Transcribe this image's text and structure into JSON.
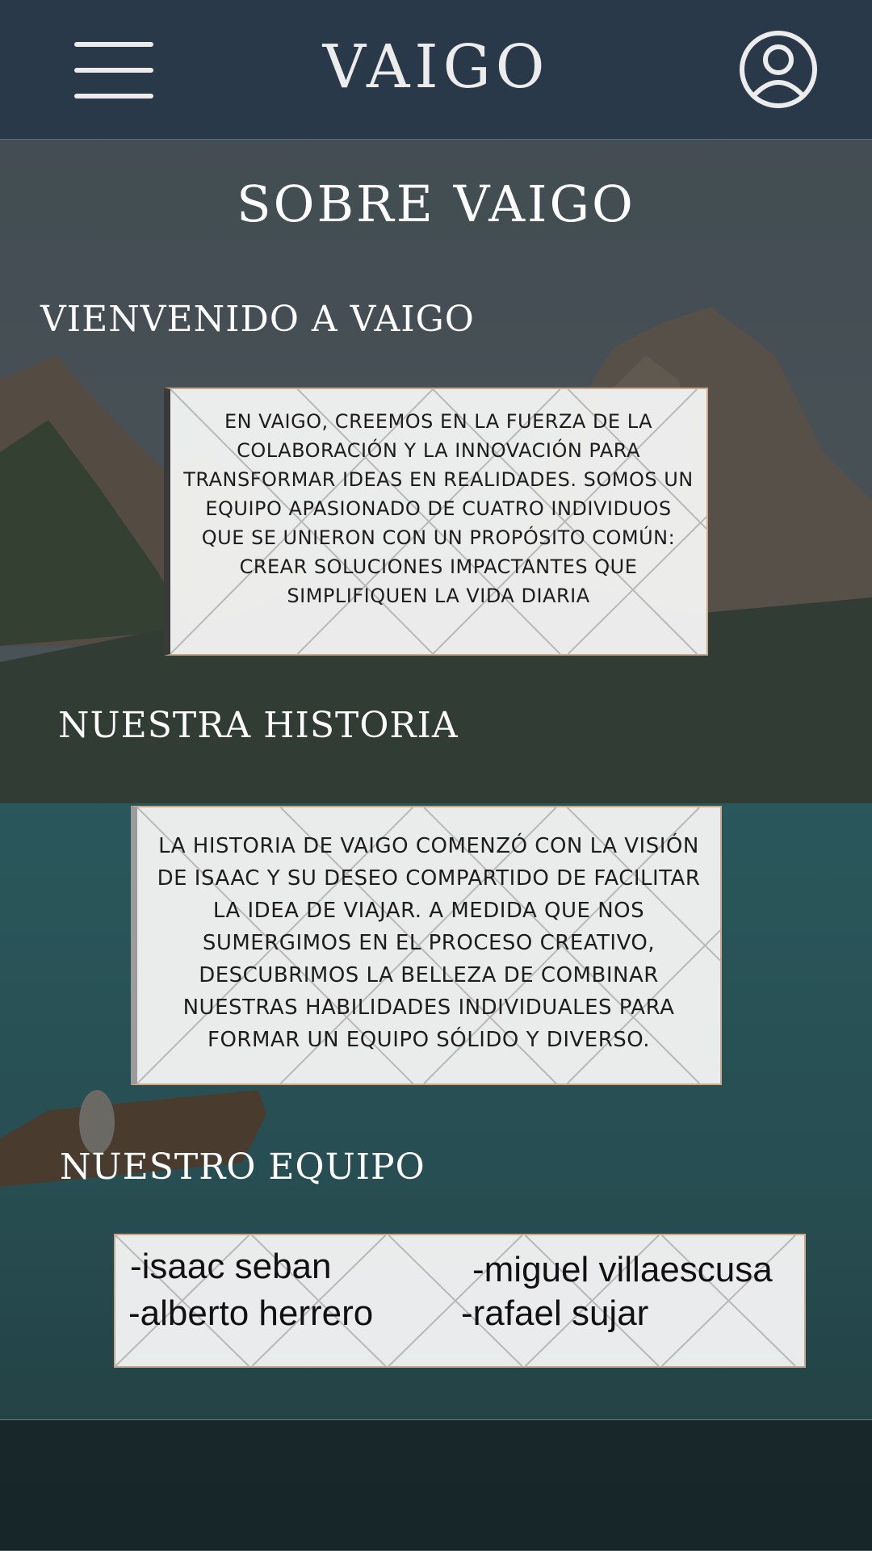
{
  "header": {
    "brand": "VAIGO",
    "menu_icon": "hamburger-menu-icon",
    "profile_icon": "user-profile-icon"
  },
  "page": {
    "title": "SOBRE VAIGO"
  },
  "welcome": {
    "heading": "VIENVENIDO A VAIGO",
    "text": "EN VAIGO, CREEMOS EN LA FUERZA DE LA COLABORACIÓN Y LA INNOVACIÓN PARA TRANSFORMAR IDEAS EN REALIDADES. SOMOS UN EQUIPO APASIONADO DE CUATRO INDIVIDUOS QUE SE UNIERON CON UN PROPÓSITO COMÚN: CREAR SOLUCIONES IMPACTANTES QUE SIMPLIFIQUEN LA VIDA DIARIA"
  },
  "history": {
    "heading": "NUESTRA HISTORIA",
    "text": "LA HISTORIA DE VAIGO COMENZÓ CON LA VISIÓN DE ISAAC Y SU DESEO COMPARTIDO DE FACILITAR LA IDEA DE VIAJAR. A MEDIDA QUE NOS SUMERGIMOS EN EL PROCESO CREATIVO, DESCUBRIMOS LA BELLEZA DE COMBINAR NUESTRAS HABILIDADES INDIVIDUALES PARA FORMAR UN EQUIPO SÓLIDO Y DIVERSO."
  },
  "team": {
    "heading": "NUESTRO EQUIPO",
    "members": [
      "-isaac seban",
      "-miguel villaescusa",
      "-alberto herrero",
      "-rafael sujar"
    ]
  },
  "colors": {
    "header_bg": "#29394a",
    "card_border": "#c6a88d",
    "text_light": "#ffffff"
  }
}
